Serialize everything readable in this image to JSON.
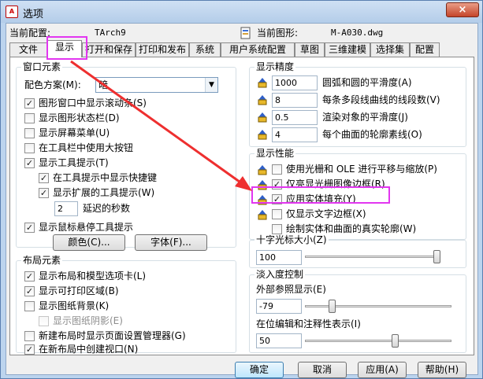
{
  "window": {
    "title": "选项",
    "close_icon": "×"
  },
  "profile": {
    "current_config_label": "当前配置:",
    "current_config_value": "TArch9",
    "current_drawing_label": "当前图形:",
    "current_drawing_value": "M-A030.dwg"
  },
  "tabs": [
    "文件",
    "显示",
    "打开和保存",
    "打印和发布",
    "系统",
    "用户系统配置",
    "草图",
    "三维建模",
    "选择集",
    "配置"
  ],
  "window_elements": {
    "title": "窗口元素",
    "color_scheme_label": "配色方案(M):",
    "color_scheme_value": "暗",
    "checks": [
      {
        "label": "图形窗口中显示滚动条(S)",
        "checked": true
      },
      {
        "label": "显示图形状态栏(D)",
        "checked": false
      },
      {
        "label": "显示屏幕菜单(U)",
        "checked": false
      },
      {
        "label": "在工具栏中使用大按钮",
        "checked": false
      },
      {
        "label": "显示工具提示(T)",
        "checked": true
      },
      {
        "label": "在工具提示中显示快捷键",
        "checked": true
      },
      {
        "label": "显示扩展的工具提示(W)",
        "checked": true
      },
      {
        "label": "显示鼠标悬停工具提示",
        "checked": true
      }
    ],
    "delay_value": "2",
    "delay_label": "延迟的秒数",
    "colors_button": "颜色(C)...",
    "fonts_button": "字体(F)..."
  },
  "layout_elements": {
    "title": "布局元素",
    "checks": [
      {
        "label": "显示布局和模型选项卡(L)",
        "checked": true
      },
      {
        "label": "显示可打印区域(B)",
        "checked": true
      },
      {
        "label": "显示图纸背景(K)",
        "checked": false
      },
      {
        "label": "显示图纸阴影(E)",
        "checked": false
      },
      {
        "label": "新建布局时显示页面设置管理器(G)",
        "checked": false
      },
      {
        "label": "在新布局中创建视口(N)",
        "checked": true
      }
    ]
  },
  "display_resolution": {
    "title": "显示精度",
    "items": [
      {
        "value": "1000",
        "label": "圆弧和圆的平滑度(A)"
      },
      {
        "value": "8",
        "label": "每条多段线曲线的线段数(V)"
      },
      {
        "value": "0.5",
        "label": "渲染对象的平滑度(J)"
      },
      {
        "value": "4",
        "label": "每个曲面的轮廓素线(O)"
      }
    ]
  },
  "display_performance": {
    "title": "显示性能",
    "checks": [
      {
        "label": "使用光栅和 OLE 进行平移与缩放(P)",
        "checked": false
      },
      {
        "label": "仅亮显光栅图像边框(R)",
        "checked": true
      },
      {
        "label": "应用实体填充(Y)",
        "checked": true
      },
      {
        "label": "仅显示文字边框(X)",
        "checked": false
      },
      {
        "label": "绘制实体和曲面的真实轮廓(W)",
        "checked": false
      }
    ]
  },
  "crosshair": {
    "title": "十字光标大小(Z)",
    "value": "100",
    "level": 100
  },
  "fade": {
    "title": "淡入度控制",
    "xref_label": "外部参照显示(E)",
    "xref_value": "-79",
    "xref_level": 0.17,
    "inplace_label": "在位编辑和注释性表示(I)",
    "inplace_value": "50",
    "inplace_level": 0.62
  },
  "buttons": {
    "ok": "确定",
    "cancel": "取消",
    "apply": "应用(A)",
    "help": "帮助(H)"
  },
  "icons": {
    "check": "✓",
    "arrow_down": "▼"
  },
  "colors": {
    "annotation": "#e236f0",
    "arrow": "#ee2f2f"
  }
}
